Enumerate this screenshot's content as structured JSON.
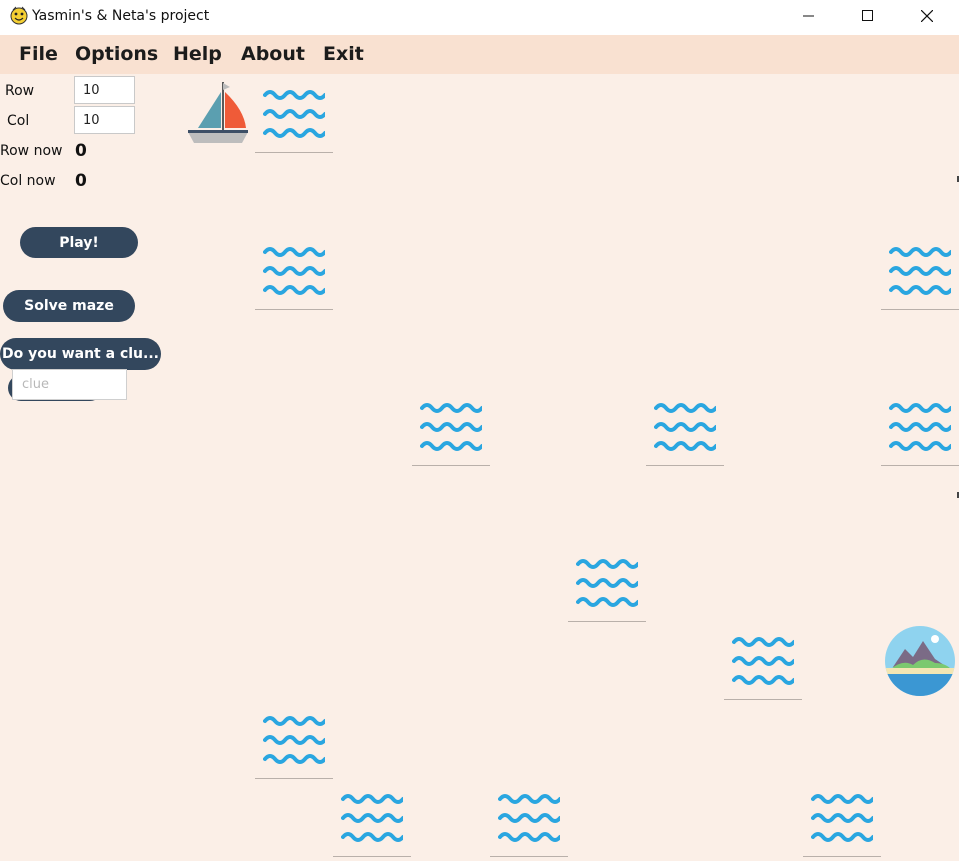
{
  "window": {
    "title": "Yasmin's & Neta's project",
    "controls": [
      "minimize-icon",
      "maximize-icon",
      "close-icon"
    ]
  },
  "menu": {
    "items": [
      "File",
      "Options",
      "Help",
      "About",
      "Exit"
    ]
  },
  "panel": {
    "row_label": "Row",
    "row_value": "10",
    "col_label": "Col",
    "col_value": "10",
    "row_now_label": "Row now",
    "row_now_value": "0",
    "col_now_label": "Col now",
    "col_now_value": "0",
    "play_label": "Play!",
    "solve_label": "Solve maze",
    "clue_button_label": "Do you want a clu...",
    "clue_placeholder": "clue"
  },
  "maze": {
    "start_icon": "sailboat-icon",
    "goal_icon": "island-icon",
    "water_icon": "water-waves-icon",
    "colors": {
      "water": "#2aa6e0",
      "background": "#fbefe7",
      "menubar": "#f9e1d1",
      "button": "#33475d"
    }
  }
}
